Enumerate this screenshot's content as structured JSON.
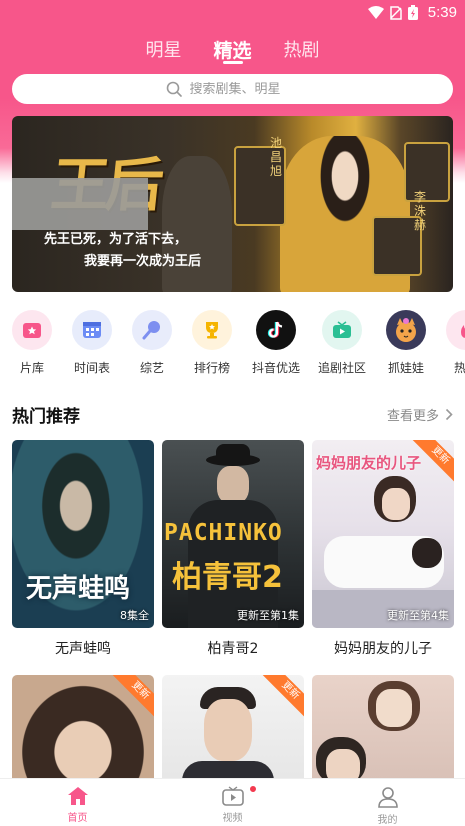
{
  "status_bar": {
    "time": "5:39",
    "battery_icon": "battery-charging-icon"
  },
  "top_tabs": [
    {
      "label": "明星",
      "active": false
    },
    {
      "label": "精选",
      "active": true
    },
    {
      "label": "热剧",
      "active": false
    }
  ],
  "search": {
    "placeholder": "搜索剧集、明星"
  },
  "banner": {
    "title": "王后",
    "tagline_1": "先王已死，为了活下去，",
    "tagline_2": "我要再一次成为王后",
    "cast_name_1": "池昌旭",
    "cast_name_2": "李洙赫"
  },
  "shortcuts": [
    {
      "label": "片库",
      "icon": "film-library-icon",
      "color": "#fde6ef"
    },
    {
      "label": "时间表",
      "icon": "calendar-icon",
      "color": "#e7ecfb"
    },
    {
      "label": "综艺",
      "icon": "variety-icon",
      "color": "#e8ecfb"
    },
    {
      "label": "排行榜",
      "icon": "trophy-icon",
      "color": "#fff3dc"
    },
    {
      "label": "抖音优选",
      "icon": "tiktok-icon",
      "color": "#111111"
    },
    {
      "label": "追剧社区",
      "icon": "tv-community-icon",
      "color": "#e2f6f0"
    },
    {
      "label": "抓娃娃",
      "icon": "claw-machine-icon",
      "color": "#3a3a5a"
    },
    {
      "label": "热剧",
      "icon": "hot-drama-icon",
      "color": "#fde6ef"
    }
  ],
  "section": {
    "title": "热门推荐",
    "more": "查看更多"
  },
  "cards": [
    {
      "caption": "无声蛙鸣",
      "poster_text": "无声蛙鸣",
      "episode": "8集全",
      "badge": ""
    },
    {
      "caption": "柏青哥2",
      "poster_text_en": "PACHINKO",
      "poster_text": "柏青哥2",
      "episode": "更新至第1集",
      "badge": ""
    },
    {
      "caption": "妈妈朋友的儿子",
      "poster_text": "妈妈朋友的儿子",
      "episode": "更新至第4集",
      "badge": "更新"
    }
  ],
  "cards_row2": [
    {
      "badge": "更新"
    },
    {
      "badge": "更新"
    },
    {
      "badge": ""
    }
  ],
  "bottom_nav": [
    {
      "label": "首页",
      "icon": "home-icon",
      "active": true
    },
    {
      "label": "视频",
      "icon": "video-icon",
      "active": false
    },
    {
      "label": "我的",
      "icon": "profile-icon",
      "active": false
    }
  ],
  "colors": {
    "accent": "#f7568a",
    "badge": "#ff7a2e"
  }
}
